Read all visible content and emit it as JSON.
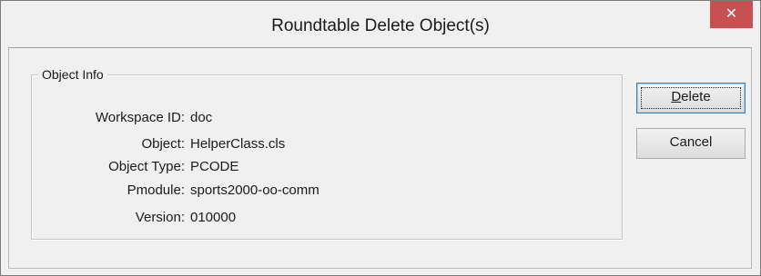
{
  "window": {
    "title": "Roundtable Delete Object(s)",
    "close_glyph": "✕"
  },
  "object_info": {
    "legend": "Object Info",
    "fields": [
      {
        "label": "Workspace ID:",
        "value": "doc"
      },
      {
        "label": "Object:",
        "value": "HelperClass.cls"
      },
      {
        "label": "Object Type:",
        "value": "PCODE"
      },
      {
        "label": "Pmodule:",
        "value": "sports2000-oo-comm"
      },
      {
        "label": "Version:",
        "value": "010000"
      }
    ]
  },
  "buttons": {
    "delete_mnemonic": "D",
    "delete_rest": "elete",
    "cancel": "Cancel"
  },
  "colors": {
    "close_button": "#c75050",
    "background": "#f0f0f0"
  }
}
